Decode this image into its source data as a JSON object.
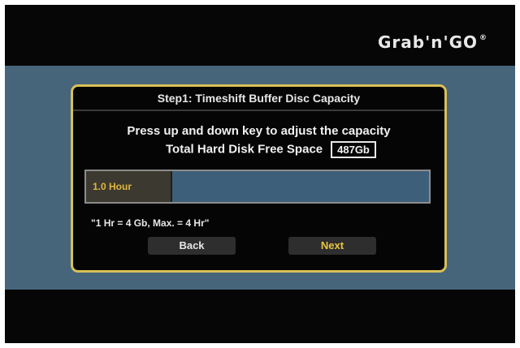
{
  "brand": {
    "name": "Grab'n'GO",
    "mark": "®"
  },
  "dialog": {
    "title": "Step1: Timeshift Buffer Disc Capacity",
    "instruction": "Press up and down key to adjust the capacity",
    "free_space_label": "Total Hard Disk Free Space",
    "free_space_value": "487Gb",
    "capacity_label": "1.0 Hour",
    "capacity_fraction": 0.25,
    "note": "\"1 Hr = 4 Gb, Max. = 4 Hr\"",
    "back_label": "Back",
    "next_label": "Next"
  },
  "colors": {
    "band": "#46657b",
    "dialog_border": "#d8c058",
    "bar_empty": "#3e5f7a",
    "bar_fill": "#3c3a30",
    "highlight_text": "#e8c640"
  }
}
